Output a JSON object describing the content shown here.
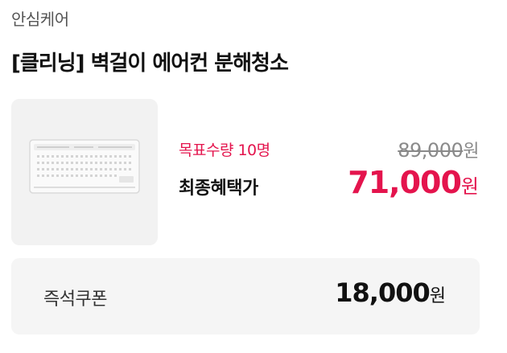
{
  "header": {
    "brand": "안심케어",
    "title": "[클리닝] 벽걸이 에어컨 분해청소"
  },
  "product": {
    "image_icon": "air-conditioner-icon",
    "target_quantity": "목표수량 10명",
    "final_price_label": "최종혜택가",
    "original_price": "89,000",
    "original_price_unit": "원",
    "final_price": "71,000",
    "final_price_unit": "원"
  },
  "coupon": {
    "label": "즉석쿠폰",
    "amount": "18,000",
    "unit": "원"
  },
  "colors": {
    "accent": "#e4144d",
    "strike_gray": "#8a8a8a",
    "card_bg": "#f2f2f2",
    "coupon_bg": "#f5f5f5"
  }
}
